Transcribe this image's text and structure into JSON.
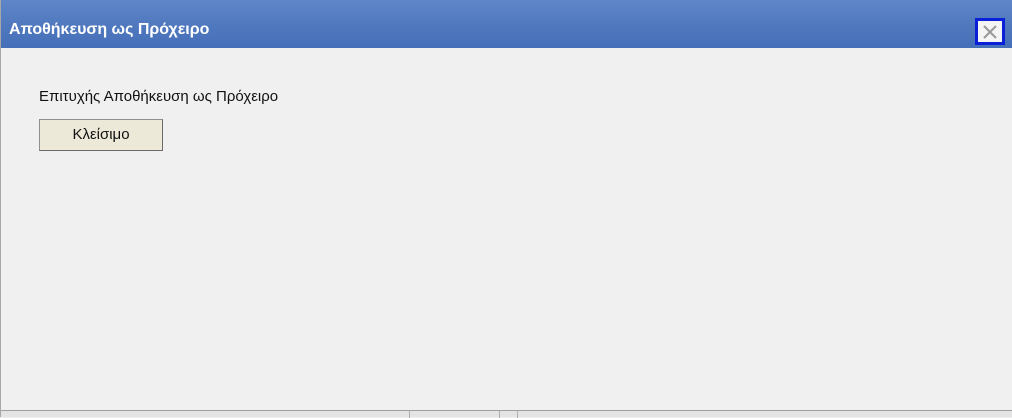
{
  "window": {
    "title": "Αποθήκευση ως Πρόχειρο",
    "close_icon": "close-icon"
  },
  "content": {
    "message": "Επιτυχής Αποθήκευση ως Πρόχειρο",
    "close_button_label": "Κλείσιμο"
  },
  "colors": {
    "titlebar": "#5079bf",
    "title_text": "#ffffff",
    "close_focus_border": "#0a1fd8",
    "background": "#f0f0f0",
    "button_face": "#ece9d8"
  }
}
